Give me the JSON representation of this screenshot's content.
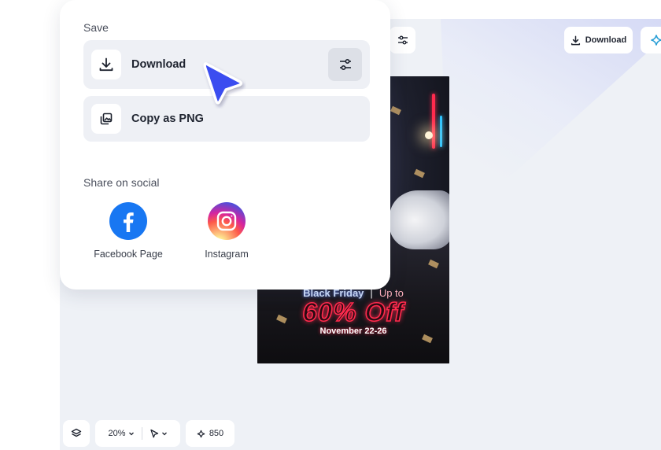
{
  "popup": {
    "save_title": "Save",
    "download_label": "Download",
    "copy_label": "Copy as PNG",
    "share_title": "Share on social",
    "social": [
      {
        "label": "Facebook Page",
        "icon": "facebook-icon"
      },
      {
        "label": "Instagram",
        "icon": "instagram-icon"
      }
    ]
  },
  "toolbar": {
    "download_label": "Download"
  },
  "poster": {
    "line1_a": "Black Friday",
    "line1_sep": "|",
    "line1_b": "Up to",
    "headline": "60% Off",
    "dates": "November 22-26"
  },
  "bottom_bar": {
    "zoom": "20%",
    "credits": "850"
  },
  "colors": {
    "accent": "#3b4ef0",
    "facebook": "#1877f2",
    "neon": "#ff2a4d",
    "canvas_bg": "#eef1f6"
  }
}
